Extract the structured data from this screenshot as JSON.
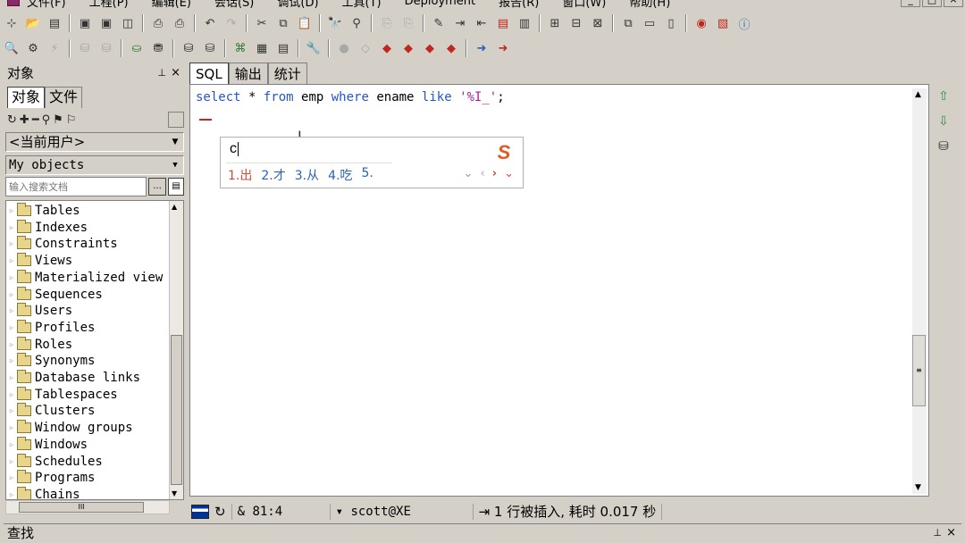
{
  "menu": {
    "items": [
      "文件(F)",
      "工程(P)",
      "编辑(E)",
      "会话(S)",
      "调试(D)",
      "工具(T)",
      "Deployment",
      "报告(R)",
      "窗口(W)",
      "帮助(H)"
    ]
  },
  "window_controls": [
    "_",
    "□",
    "×"
  ],
  "left_panel": {
    "title": "对象",
    "tabs": [
      "对象",
      "文件"
    ],
    "user_combo": "<当前用户>",
    "filter_combo": "My objects",
    "search_placeholder": "输入搜索文档",
    "search_btn": "...",
    "tree": [
      "Tables",
      "Indexes",
      "Constraints",
      "Views",
      "Materialized view",
      "Sequences",
      "Users",
      "Profiles",
      "Roles",
      "Synonyms",
      "Database links",
      "Tablespaces",
      "Clusters",
      "Window groups",
      "Windows",
      "Schedules",
      "Programs",
      "Chains"
    ],
    "hscroll_grip": "III"
  },
  "editor": {
    "tabs": [
      "SQL",
      "输出",
      "统计"
    ],
    "sql": {
      "select": "select",
      "star": " * ",
      "from": "from",
      "table": " emp ",
      "where": "where",
      "col": " ename ",
      "like": "like",
      "space": " ",
      "literal": "'%I_'",
      "end": ";"
    },
    "scroll_grip": "≡"
  },
  "ime": {
    "composition": "c",
    "logo": "S",
    "candidates": [
      "1.出",
      "2.才",
      "3.从",
      "4.吃",
      "5."
    ],
    "nav": {
      "down": "⌄",
      "prev": "‹",
      "next": "›",
      "more": "⌄"
    }
  },
  "status": {
    "position": "81:4",
    "connection": "scott@XE",
    "message": "1 行被插入, 耗时 0.017 秒"
  },
  "find_bar": {
    "title": "查找"
  },
  "colors": {
    "keyword": "#2255cc",
    "string": "#a020a0",
    "ime_first": "#d24b3c",
    "ime_candidate": "#2a63b8"
  }
}
